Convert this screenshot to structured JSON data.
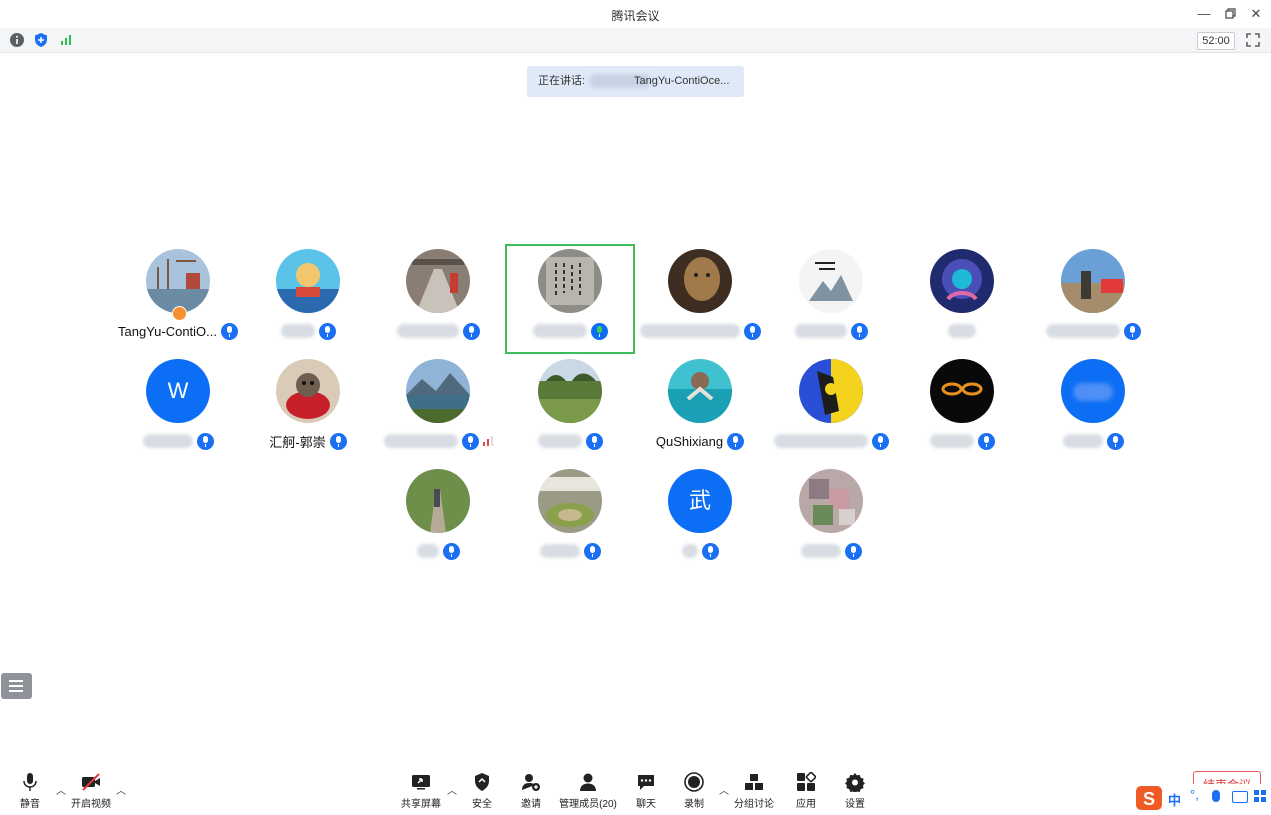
{
  "window": {
    "title": "腾讯会议"
  },
  "toolbar": {
    "timer": "52:00"
  },
  "speaking": {
    "label": "正在讲话: ",
    "name": "TangYu-ContiOce..."
  },
  "participants": [
    {
      "name": "TangYu-ContiO...",
      "avatar": "photo-port-cranes",
      "host": true
    },
    {
      "name": "",
      "avatar": "photo-cartoon"
    },
    {
      "name": "",
      "avatar": "photo-subway"
    },
    {
      "name": "",
      "avatar": "photo-calligraphy",
      "active": true
    },
    {
      "name": "",
      "avatar": "photo-leopard"
    },
    {
      "name": "",
      "avatar": "photo-ink-painting"
    },
    {
      "name": "",
      "avatar": "photo-lion-art"
    },
    {
      "name": "",
      "avatar": "photo-outdoor"
    },
    {
      "name": "",
      "avatar": "letter",
      "letter": "W"
    },
    {
      "name": "汇舸-郭崇",
      "avatar": "photo-cat"
    },
    {
      "name": "",
      "avatar": "photo-lake"
    },
    {
      "name": "",
      "avatar": "photo-field"
    },
    {
      "name": "QuShixiang",
      "avatar": "photo-swimmer"
    },
    {
      "name": "",
      "avatar": "photo-cartoon-yellow"
    },
    {
      "name": "",
      "avatar": "photo-dark-glasses"
    },
    {
      "name": "",
      "avatar": "letter-blurred",
      "letter": ""
    },
    {
      "name": "",
      "avatar": "photo-path"
    },
    {
      "name": "",
      "avatar": "photo-garden"
    },
    {
      "name": "",
      "avatar": "letter",
      "letter": "武"
    },
    {
      "name": "",
      "avatar": "photo-blurred"
    }
  ],
  "bottombar": {
    "mute": "静音",
    "video": "开启视频",
    "share": "共享屏幕",
    "security": "安全",
    "invite": "邀请",
    "members": "管理成员(20)",
    "chat": "聊天",
    "record": "录制",
    "breakout": "分组讨论",
    "apps": "应用",
    "settings": "设置",
    "end": "结束会议"
  },
  "ime": {
    "lang": "中"
  },
  "colors": {
    "accent": "#0b6ef5",
    "active_border": "#3dbd5b",
    "end": "#e23b3b"
  }
}
